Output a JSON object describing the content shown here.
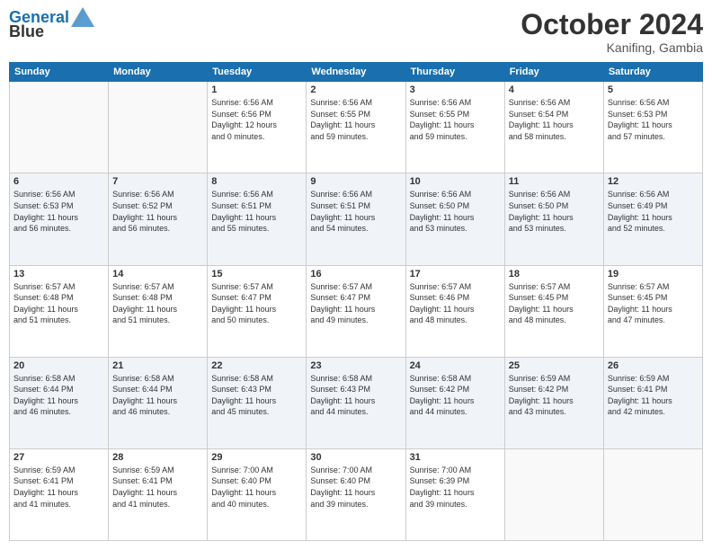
{
  "logo": {
    "line1": "General",
    "line2": "Blue"
  },
  "title": "October 2024",
  "location": "Kanifing, Gambia",
  "weekdays": [
    "Sunday",
    "Monday",
    "Tuesday",
    "Wednesday",
    "Thursday",
    "Friday",
    "Saturday"
  ],
  "weeks": [
    [
      {
        "day": "",
        "info": ""
      },
      {
        "day": "",
        "info": ""
      },
      {
        "day": "1",
        "info": "Sunrise: 6:56 AM\nSunset: 6:56 PM\nDaylight: 12 hours\nand 0 minutes."
      },
      {
        "day": "2",
        "info": "Sunrise: 6:56 AM\nSunset: 6:55 PM\nDaylight: 11 hours\nand 59 minutes."
      },
      {
        "day": "3",
        "info": "Sunrise: 6:56 AM\nSunset: 6:55 PM\nDaylight: 11 hours\nand 59 minutes."
      },
      {
        "day": "4",
        "info": "Sunrise: 6:56 AM\nSunset: 6:54 PM\nDaylight: 11 hours\nand 58 minutes."
      },
      {
        "day": "5",
        "info": "Sunrise: 6:56 AM\nSunset: 6:53 PM\nDaylight: 11 hours\nand 57 minutes."
      }
    ],
    [
      {
        "day": "6",
        "info": "Sunrise: 6:56 AM\nSunset: 6:53 PM\nDaylight: 11 hours\nand 56 minutes."
      },
      {
        "day": "7",
        "info": "Sunrise: 6:56 AM\nSunset: 6:52 PM\nDaylight: 11 hours\nand 56 minutes."
      },
      {
        "day": "8",
        "info": "Sunrise: 6:56 AM\nSunset: 6:51 PM\nDaylight: 11 hours\nand 55 minutes."
      },
      {
        "day": "9",
        "info": "Sunrise: 6:56 AM\nSunset: 6:51 PM\nDaylight: 11 hours\nand 54 minutes."
      },
      {
        "day": "10",
        "info": "Sunrise: 6:56 AM\nSunset: 6:50 PM\nDaylight: 11 hours\nand 53 minutes."
      },
      {
        "day": "11",
        "info": "Sunrise: 6:56 AM\nSunset: 6:50 PM\nDaylight: 11 hours\nand 53 minutes."
      },
      {
        "day": "12",
        "info": "Sunrise: 6:56 AM\nSunset: 6:49 PM\nDaylight: 11 hours\nand 52 minutes."
      }
    ],
    [
      {
        "day": "13",
        "info": "Sunrise: 6:57 AM\nSunset: 6:48 PM\nDaylight: 11 hours\nand 51 minutes."
      },
      {
        "day": "14",
        "info": "Sunrise: 6:57 AM\nSunset: 6:48 PM\nDaylight: 11 hours\nand 51 minutes."
      },
      {
        "day": "15",
        "info": "Sunrise: 6:57 AM\nSunset: 6:47 PM\nDaylight: 11 hours\nand 50 minutes."
      },
      {
        "day": "16",
        "info": "Sunrise: 6:57 AM\nSunset: 6:47 PM\nDaylight: 11 hours\nand 49 minutes."
      },
      {
        "day": "17",
        "info": "Sunrise: 6:57 AM\nSunset: 6:46 PM\nDaylight: 11 hours\nand 48 minutes."
      },
      {
        "day": "18",
        "info": "Sunrise: 6:57 AM\nSunset: 6:45 PM\nDaylight: 11 hours\nand 48 minutes."
      },
      {
        "day": "19",
        "info": "Sunrise: 6:57 AM\nSunset: 6:45 PM\nDaylight: 11 hours\nand 47 minutes."
      }
    ],
    [
      {
        "day": "20",
        "info": "Sunrise: 6:58 AM\nSunset: 6:44 PM\nDaylight: 11 hours\nand 46 minutes."
      },
      {
        "day": "21",
        "info": "Sunrise: 6:58 AM\nSunset: 6:44 PM\nDaylight: 11 hours\nand 46 minutes."
      },
      {
        "day": "22",
        "info": "Sunrise: 6:58 AM\nSunset: 6:43 PM\nDaylight: 11 hours\nand 45 minutes."
      },
      {
        "day": "23",
        "info": "Sunrise: 6:58 AM\nSunset: 6:43 PM\nDaylight: 11 hours\nand 44 minutes."
      },
      {
        "day": "24",
        "info": "Sunrise: 6:58 AM\nSunset: 6:42 PM\nDaylight: 11 hours\nand 44 minutes."
      },
      {
        "day": "25",
        "info": "Sunrise: 6:59 AM\nSunset: 6:42 PM\nDaylight: 11 hours\nand 43 minutes."
      },
      {
        "day": "26",
        "info": "Sunrise: 6:59 AM\nSunset: 6:41 PM\nDaylight: 11 hours\nand 42 minutes."
      }
    ],
    [
      {
        "day": "27",
        "info": "Sunrise: 6:59 AM\nSunset: 6:41 PM\nDaylight: 11 hours\nand 41 minutes."
      },
      {
        "day": "28",
        "info": "Sunrise: 6:59 AM\nSunset: 6:41 PM\nDaylight: 11 hours\nand 41 minutes."
      },
      {
        "day": "29",
        "info": "Sunrise: 7:00 AM\nSunset: 6:40 PM\nDaylight: 11 hours\nand 40 minutes."
      },
      {
        "day": "30",
        "info": "Sunrise: 7:00 AM\nSunset: 6:40 PM\nDaylight: 11 hours\nand 39 minutes."
      },
      {
        "day": "31",
        "info": "Sunrise: 7:00 AM\nSunset: 6:39 PM\nDaylight: 11 hours\nand 39 minutes."
      },
      {
        "day": "",
        "info": ""
      },
      {
        "day": "",
        "info": ""
      }
    ]
  ]
}
